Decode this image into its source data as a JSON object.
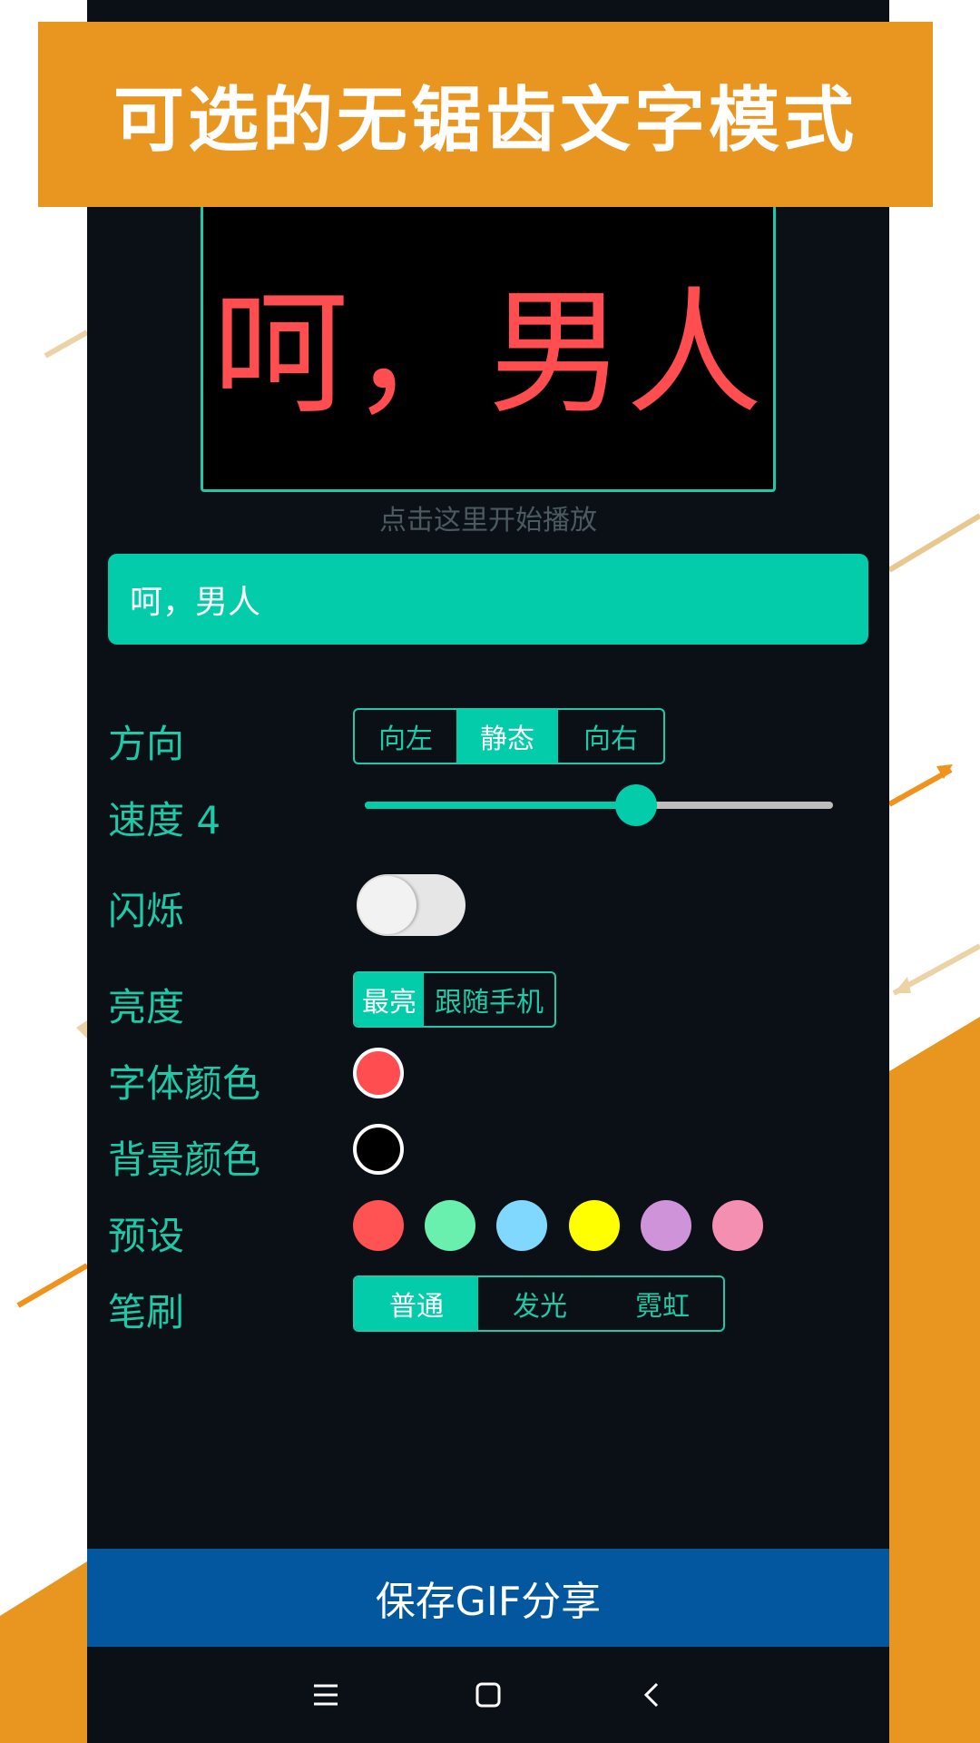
{
  "banner": {
    "title": "可选的无锯齿文字模式"
  },
  "preview": {
    "text": "呵，男人",
    "hint": "点击这里开始播放"
  },
  "text_input": {
    "value": "呵，男人"
  },
  "direction": {
    "label": "方向",
    "options": [
      "向左",
      "静态",
      "向右"
    ],
    "selected": "静态"
  },
  "speed": {
    "label": "速度 4",
    "value_fraction": 0.58
  },
  "blink": {
    "label": "闪烁",
    "on": false
  },
  "brightness": {
    "label": "亮度",
    "options": [
      "最亮",
      "跟随手机"
    ],
    "selected": "最亮"
  },
  "font_color": {
    "label": "字体颜色",
    "color": "#ff4d50"
  },
  "bg_color": {
    "label": "背景颜色",
    "color": "#000000"
  },
  "presets": {
    "label": "预设",
    "colors": [
      "#ff5252",
      "#69f0ae",
      "#80d8ff",
      "#ffff00",
      "#ce93d8",
      "#f48fb1"
    ]
  },
  "brush": {
    "label": "笔刷",
    "options": [
      "普通",
      "发光",
      "霓虹"
    ],
    "selected": "普通"
  },
  "save_button": {
    "label": "保存GIF分享"
  },
  "navbar": {
    "icons": [
      "menu-icon",
      "home-icon",
      "back-icon"
    ]
  },
  "colors": {
    "accent": "#02ccaa",
    "banner": "#e99620",
    "save": "#02579e",
    "screen_bg": "#0b1016"
  }
}
